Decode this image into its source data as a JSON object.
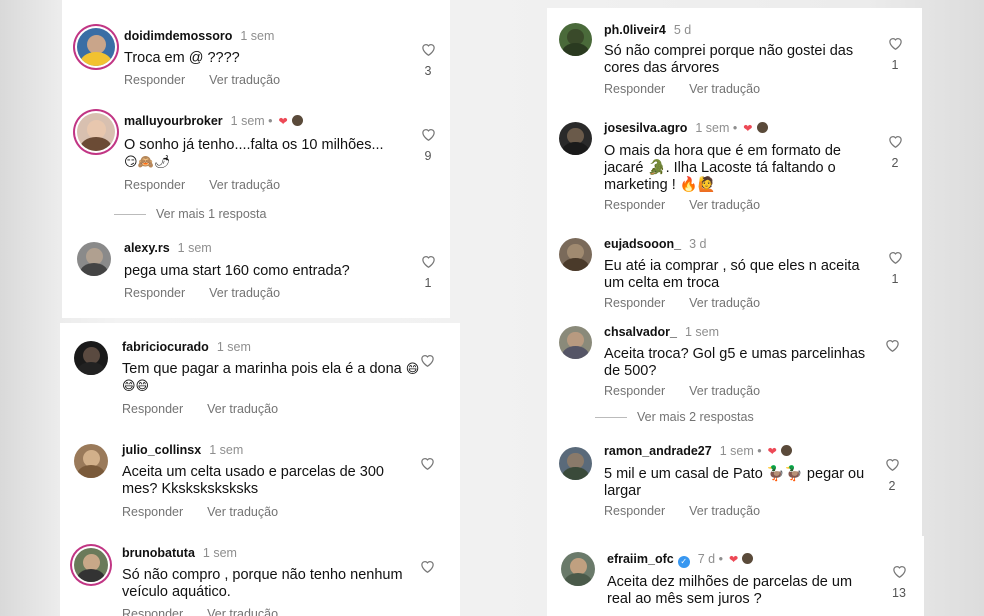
{
  "ui": {
    "reply_label": "Responder",
    "translate_label": "Ver tradução"
  },
  "left_top": [
    {
      "user": "doidimdemossoro",
      "time": "1 sem",
      "text": "Troca em @ ????",
      "likes": "3",
      "author_like": false,
      "ring": true
    },
    {
      "user": "malluyourbroker",
      "time": "1 sem",
      "text": "O sonho já tenho....falta os 10 milhões...",
      "emoji_line": "😏🙈🌶",
      "likes": "9",
      "author_like": true,
      "ring": true
    },
    {
      "user": "alexy.rs",
      "time": "1 sem",
      "text": "pega uma start 160 como entrada?",
      "likes": "1",
      "author_like": false,
      "ring": false
    }
  ],
  "left_more_replies": "Ver mais 1 resposta",
  "left_bottom": [
    {
      "user": "fabriciocurado",
      "time": "1 sem",
      "text": "Tem que pagar a marinha pois ela é a dona",
      "emoji_line": "😄😄😄",
      "likes": "",
      "author_like": false
    },
    {
      "user": "julio_collinsx",
      "time": "1 sem",
      "text": "Aceita um celta usado e parcelas de 300 mes? Kksksksksksks",
      "likes": "",
      "author_like": false
    },
    {
      "user": "brunobatuta",
      "time": "1 sem",
      "text": "Só não compro , porque não tenho nenhum veículo aquático.",
      "likes": "",
      "author_like": false,
      "ring": true
    }
  ],
  "right": [
    {
      "user": "ph.0liveir4",
      "time": "5 d",
      "text": "Só não comprei porque não gostei das cores das árvores",
      "likes": "1",
      "author_like": false
    },
    {
      "user": "josesilva.agro",
      "time": "1 sem",
      "text": "O mais da hora que é em formato de jacaré 🐊. Ilha Lacoste tá faltando o marketing ! 🔥🙋",
      "likes": "2",
      "author_like": true
    },
    {
      "user": "eujadsooon_",
      "time": "3 d",
      "text": "Eu até ia comprar , só que eles n aceita um celta em troca",
      "likes": "1",
      "author_like": false
    },
    {
      "user": "chsalvador_",
      "time": "1 sem",
      "text": "Aceita troca? Gol g5 e umas parcelinhas de 500?",
      "likes": "",
      "author_like": false
    },
    {
      "user": "ramon_andrade27",
      "time": "1 sem",
      "text": "5 mil e um casal de Pato 🦆🦆 pegar ou largar",
      "likes": "2",
      "author_like": true
    },
    {
      "user": "efraiim_ofc",
      "time": "7 d",
      "text": "Aceita dez milhões de parcelas de um real ao mês sem juros ?",
      "likes": "13",
      "author_like": true,
      "verified": true
    }
  ],
  "right_more_replies": "Ver mais 2 respostas",
  "colors": {
    "heart_red": "#ed4956",
    "story_ring": "#c13584",
    "verified_blue": "#3897f0",
    "meta_gray": "#8e8e8e"
  }
}
